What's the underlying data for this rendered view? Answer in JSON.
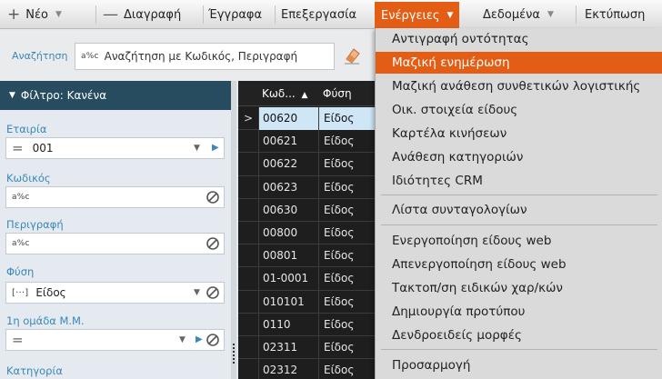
{
  "toolbar": {
    "new_label": "Νέο",
    "delete_label": "Διαγραφή",
    "record_label": "Έγγραφα",
    "process_label": "Επεξεργασία",
    "actions_label": "Ενέργειες",
    "data_label": "Δεδομένα",
    "print_label": "Εκτύπωση"
  },
  "search": {
    "label": "Αναζήτηση",
    "abc_badge": "a%c",
    "placeholder": "Αναζήτηση με Κωδικός, Περιγραφή"
  },
  "filter": {
    "header": "Φίλτρο: Κανένα",
    "fields": [
      {
        "label": "Εταιρία",
        "value": "001"
      },
      {
        "label": "Κωδικός",
        "value": ""
      },
      {
        "label": "Περιγραφή",
        "value": ""
      },
      {
        "label": "Φύση",
        "value": "Είδος",
        "prefix": "[···]"
      },
      {
        "label": "1η ομάδα Μ.Μ.",
        "value": ""
      },
      {
        "label": "Κατηγορία",
        "value": ""
      }
    ]
  },
  "grid": {
    "columns": [
      "Κωδ...",
      "Φύση"
    ],
    "rows": [
      {
        "code": "00620",
        "type": "Είδος"
      },
      {
        "code": "00621",
        "type": "Είδος"
      },
      {
        "code": "00622",
        "type": "Είδος"
      },
      {
        "code": "00623",
        "type": "Είδος"
      },
      {
        "code": "00630",
        "type": "Είδος"
      },
      {
        "code": "00800",
        "type": "Είδος"
      },
      {
        "code": "00801",
        "type": "Είδος"
      },
      {
        "code": "01-0001",
        "type": "Είδος"
      },
      {
        "code": "010101",
        "type": "Είδος"
      },
      {
        "code": "0110",
        "type": "Είδος"
      },
      {
        "code": "02311",
        "type": "Είδος"
      },
      {
        "code": "02312",
        "type": "Είδος"
      }
    ]
  },
  "menu": {
    "items": [
      "Αντιγραφή οντότητας",
      "Μαζική ενημέρωση",
      "Μαζική ανάθεση συνθετικών λογιστικής",
      "Οικ. στοιχεία είδους",
      "Καρτέλα κινήσεων",
      "Ανάθεση κατηγοριών",
      "Ιδιότητες CRM",
      "Λίστα συνταγολογίων",
      "Ενεργοποίηση είδους web",
      "Απενεργοποίηση είδους web",
      "Τακτοπ/ση ειδικών χαρ/κών",
      "Δημιουργία προτύπου",
      "Δενδροειδείς μορφές",
      "Προσαρμογή"
    ]
  },
  "colors": {
    "accent": "#e45d14",
    "filter_header": "#284c5f",
    "label_blue": "#3a87b8",
    "selected_row": "#cfe6f7"
  }
}
